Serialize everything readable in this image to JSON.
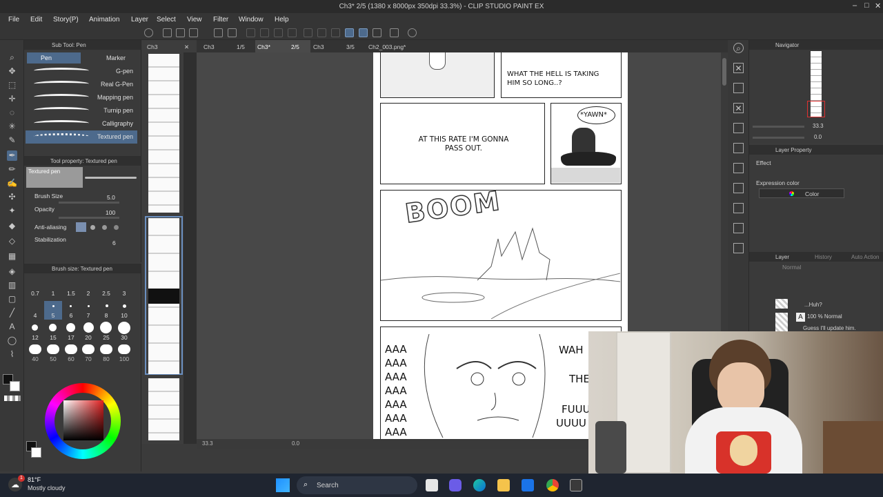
{
  "window": {
    "title": "Ch3* 2/5 (1380 x 8000px 350dpi 33.3%) - CLIP STUDIO PAINT EX"
  },
  "menu": [
    "File",
    "Edit",
    "Story(P)",
    "Animation",
    "Layer",
    "Select",
    "View",
    "Filter",
    "Window",
    "Help"
  ],
  "tabs": {
    "tab1": "Ch3",
    "tab1_page": "1/5",
    "tab2": "Ch3*",
    "tab2_page": "2/5",
    "tab3": "Ch3",
    "tab3_page": "3/5",
    "tab4": "Ch2_003.png*"
  },
  "subtool": {
    "header": "Sub Tool: Pen",
    "group_pen": "Pen",
    "group_marker": "Marker",
    "brushes": [
      "G-pen",
      "Real G-Pen",
      "Mapping pen",
      "Turnip pen",
      "Calligraphy",
      "Textured pen"
    ]
  },
  "toolprop": {
    "header": "Tool property: Textured pen",
    "preview_label": "Textured pen",
    "brush_size_label": "Brush Size",
    "brush_size_value": "5.0",
    "opacity_label": "Opacity",
    "opacity_value": "100",
    "antialias_label": "Anti-aliasing",
    "stabilization_label": "Stabilization",
    "stabilization_value": "6"
  },
  "brushsize": {
    "header": "Brush size: Textured pen",
    "row1": [
      "0.7",
      "1",
      "1.5",
      "2",
      "2.5",
      "3"
    ],
    "row2": [
      "4",
      "5",
      "6",
      "7",
      "8",
      "10"
    ],
    "row3": [
      "12",
      "15",
      "17",
      "20",
      "25",
      "30"
    ],
    "row4": [
      "40",
      "50",
      "60",
      "70",
      "80",
      "100"
    ]
  },
  "comic": {
    "bubble1": "WHAT THE HELL IS TAKING HIM SO LONG..?",
    "bubble2": "AT THIS RATE I'M GONNA PASS OUT.",
    "yawn": "*YAWN*",
    "boom": "BOOM",
    "scream": [
      "AAA",
      "AAA",
      "AAA",
      "AAA",
      "AAA",
      "AAA",
      "AAA"
    ],
    "right_text": [
      "WAH",
      "THE",
      "FUUU",
      "UUUU"
    ]
  },
  "statusbar": {
    "zoom": "33.3",
    "angle": "0.0"
  },
  "navigator": {
    "header": "Navigator",
    "zoom": "33.3",
    "angle": "0.0"
  },
  "layerprop": {
    "header": "Layer Property",
    "effect": "Effect",
    "expression_label": "Expression color",
    "expression_value": "Color"
  },
  "layers": {
    "header": "Layer",
    "tab2": "History",
    "tab3": "Auto Action",
    "blend": "Normal",
    "items": [
      {
        "name": "...Huh?"
      },
      {
        "name": "100 % Normal",
        "sub": "Guess I'll update him."
      }
    ]
  },
  "weather": {
    "temp": "81°F",
    "desc": "Mostly cloudy",
    "badge": "1"
  },
  "taskbar": {
    "search_placeholder": "Search"
  },
  "colors": {
    "accent": "#4d6a8c",
    "bg": "#3b3b3b",
    "taskbar": "#1f2530"
  }
}
